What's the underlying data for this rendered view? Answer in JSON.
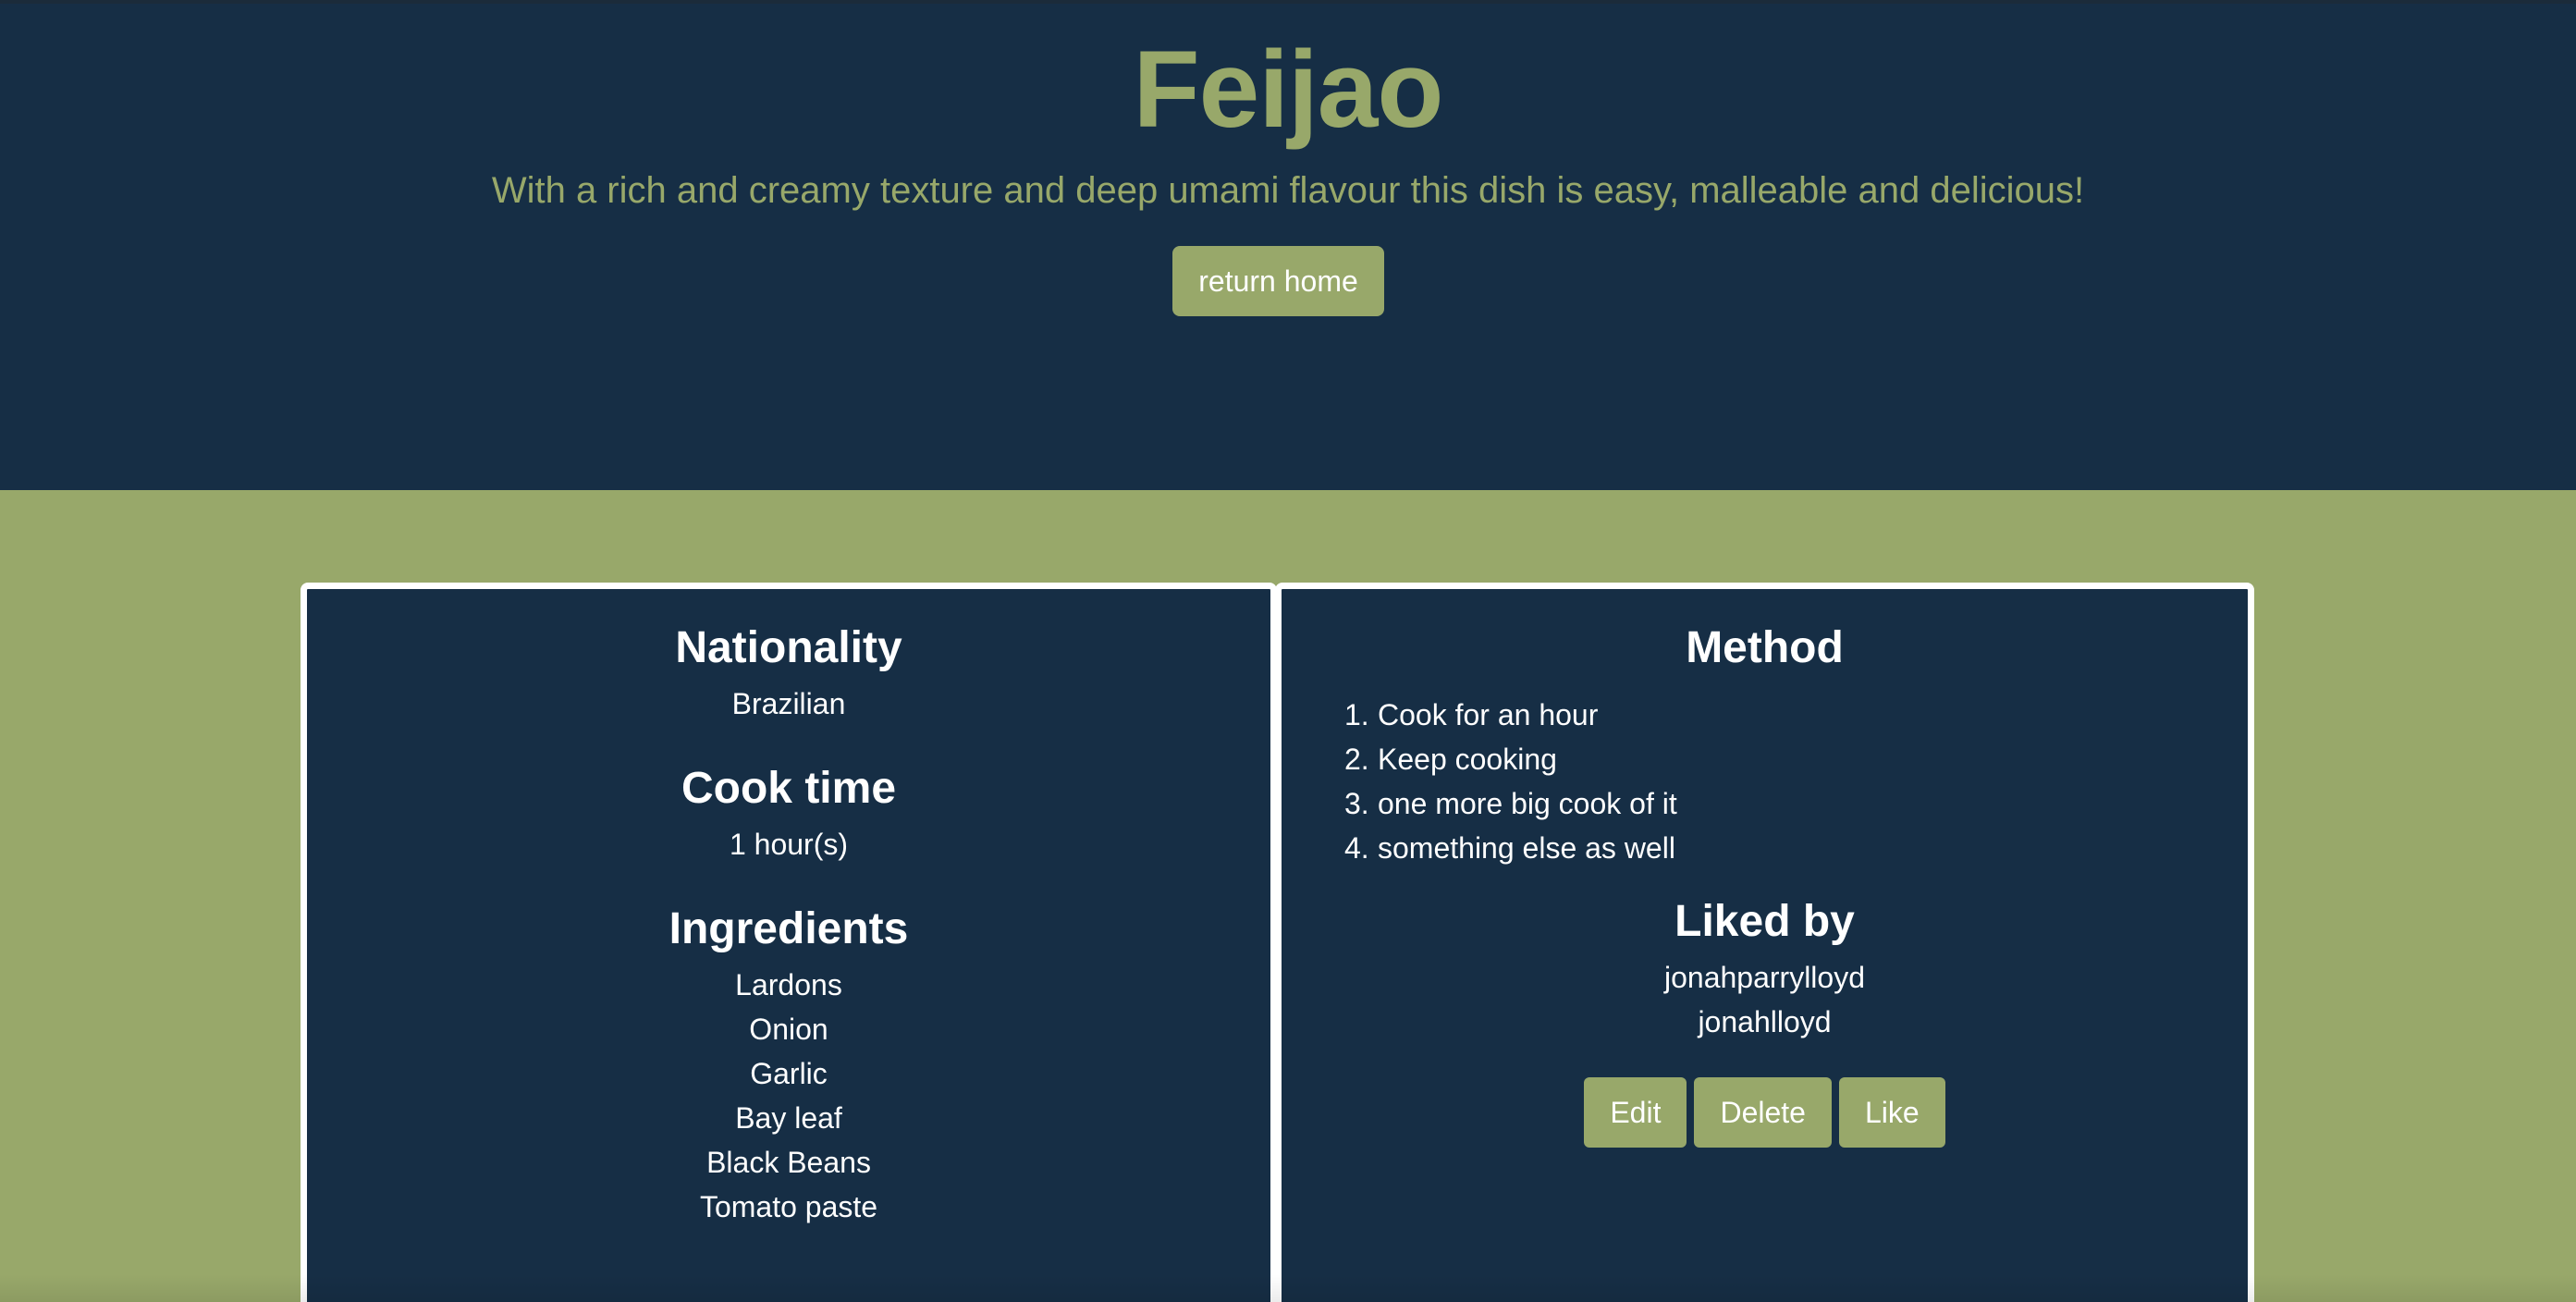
{
  "colors": {
    "hero_bg": "#162e45",
    "accent": "#98a86a",
    "card_bg": "#162e45",
    "card_border": "#ffffff",
    "text_light": "#ffffff"
  },
  "hero": {
    "title": "Feijao",
    "subtitle": "With a rich and creamy texture and deep umami flavour this dish is easy, malleable and delicious!",
    "return_label": "return home"
  },
  "details": {
    "nationality_heading": "Nationality",
    "nationality_value": "Brazilian",
    "cook_time_heading": "Cook time",
    "cook_time_value": "1 hour(s)",
    "ingredients_heading": "Ingredients",
    "ingredients": [
      "Lardons",
      "Onion",
      "Garlic",
      "Bay leaf",
      "Black Beans",
      "Tomato paste"
    ]
  },
  "method": {
    "heading": "Method",
    "steps": [
      {
        "num": "1.",
        "text": "Cook for an hour"
      },
      {
        "num": "2.",
        "text": "Keep cooking"
      },
      {
        "num": "3.",
        "text": "one more big cook of it"
      },
      {
        "num": "4.",
        "text": "something else as well"
      }
    ]
  },
  "liked_by": {
    "heading": "Liked by",
    "users": [
      "jonahparrylloyd",
      "jonahlloyd"
    ]
  },
  "actions": {
    "edit_label": "Edit",
    "delete_label": "Delete",
    "like_label": "Like"
  }
}
